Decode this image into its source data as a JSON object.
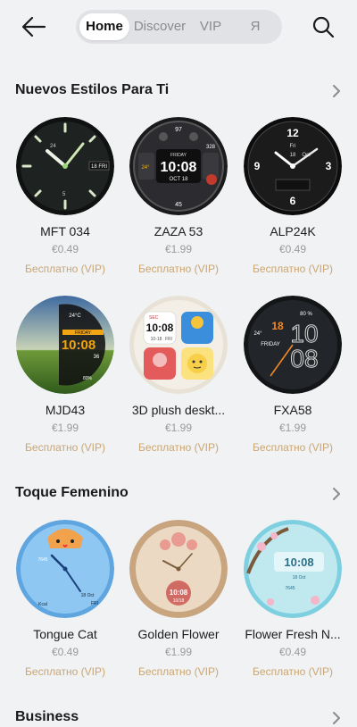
{
  "header": {
    "tabs": [
      {
        "label": "Home",
        "active": true
      },
      {
        "label": "Discover",
        "active": false
      },
      {
        "label": "VIP",
        "active": false
      },
      {
        "label": "Я",
        "active": false
      }
    ],
    "icons": {
      "back": "arrow-left-icon",
      "search": "search-icon",
      "more": "chevron-right-icon"
    }
  },
  "sections": [
    {
      "title": "Nuevos Estilos Para Ti",
      "items": [
        {
          "name": "MFT 034",
          "price": "€0.49",
          "vip": "Бесплатно (VIP)"
        },
        {
          "name": "ZAZA 53",
          "price": "€1.99",
          "vip": "Бесплатно (VIP)"
        },
        {
          "name": "ALP24K",
          "price": "€0.49",
          "vip": "Бесплатно (VIP)"
        },
        {
          "name": "MJD43",
          "price": "€1.99",
          "vip": "Бесплатно (VIP)"
        },
        {
          "name": "3D plush deskt...",
          "price": "€1.99",
          "vip": "Бесплатно (VIP)"
        },
        {
          "name": "FXA58",
          "price": "€1.99",
          "vip": "Бесплатно (VIP)"
        }
      ]
    },
    {
      "title": "Toque Femenino",
      "items": [
        {
          "name": "Tongue Cat",
          "price": "€0.49",
          "vip": "Бесплатно (VIP)"
        },
        {
          "name": "Golden Flower",
          "price": "€1.99",
          "vip": "Бесплатно (VIP)"
        },
        {
          "name": "Flower Fresh N...",
          "price": "€0.49",
          "vip": "Бесплатно (VIP)"
        }
      ]
    },
    {
      "title": "Business",
      "items": []
    }
  ],
  "faces": {
    "mft034": {
      "date": "18 FRI",
      "small": [
        "24",
        "5"
      ]
    },
    "zaza53": {
      "day": "FRIDAY",
      "time": "10:08",
      "date": "OCT 18",
      "top": "97",
      "bottom": "45",
      "left": "24°",
      "right": "328"
    },
    "alp24k": {
      "day": "Fri",
      "date": "18",
      "unit": "Oct"
    },
    "mjd43": {
      "day": "FRIDAY",
      "time": "10:08",
      "sec": "36",
      "temp": "24°C",
      "batt": "80%"
    },
    "plush": {
      "time": "10:08",
      "date": "10-18",
      "day": "FRI",
      "month": "SEC"
    },
    "fxa58": {
      "h": "10",
      "m": "08",
      "day": "FRIDAY",
      "date": "18",
      "batt": "80 %",
      "temp": "24°"
    },
    "tcat": {
      "date": "18 Oct",
      "day": "FRI",
      "steps": "7645",
      "kcal": "Kcal"
    },
    "golden": {
      "time": "10:08",
      "date": "10/18"
    },
    "flower": {
      "time": "10:08",
      "date": "18 Oct",
      "steps": "7645"
    }
  },
  "colors": {
    "vip": "#c9a673",
    "background": "#f1f2f4",
    "tab_bg": "#e1e2e5"
  }
}
